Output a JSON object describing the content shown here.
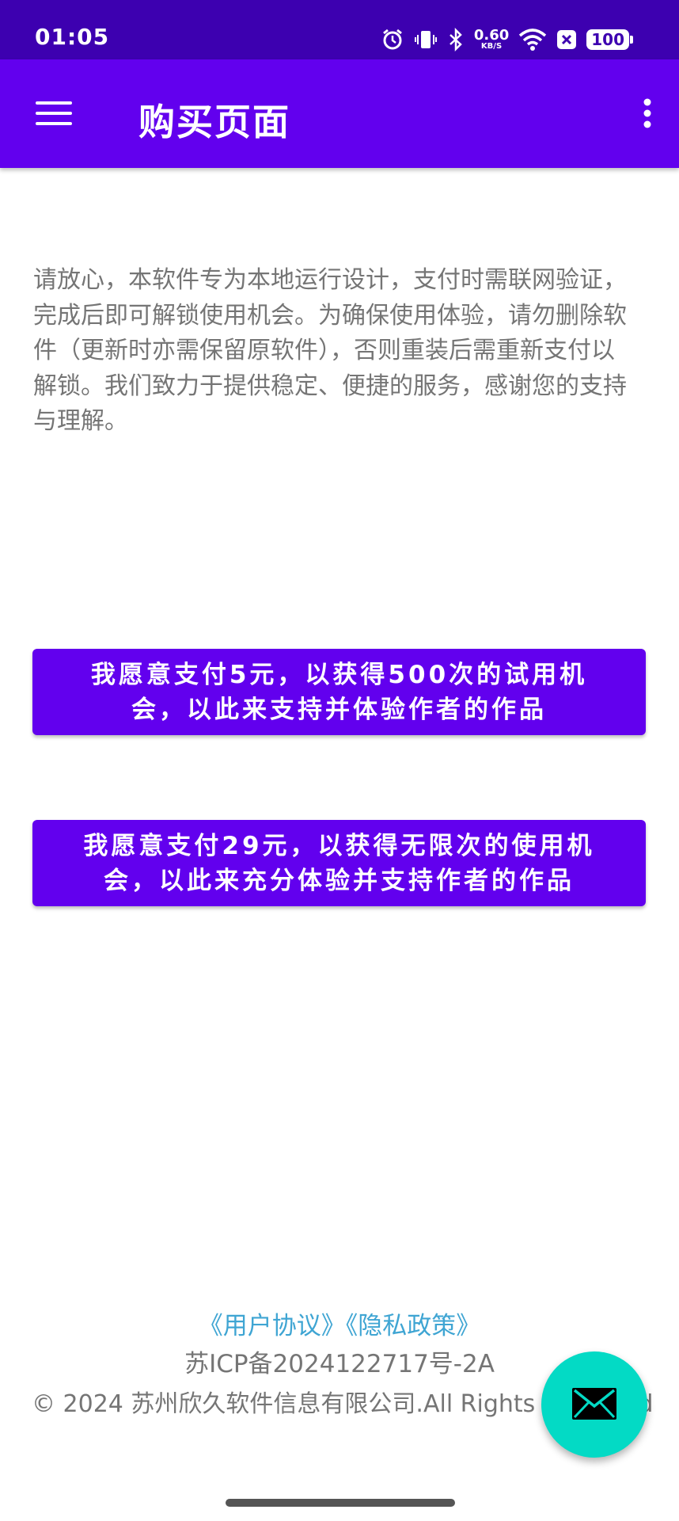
{
  "status_bar": {
    "time": "01:05",
    "net_speed": "0.60",
    "net_speed_unit": "KB/S",
    "battery": "100",
    "icons": [
      "alarm-icon",
      "vibrate-icon",
      "bluetooth-icon",
      "wifi-icon",
      "x-notification-icon",
      "battery-icon"
    ]
  },
  "app_bar": {
    "title": "购买页面",
    "menu_icon": "hamburger-menu-icon",
    "more_icon": "more-vert-icon",
    "color": "#6200ee"
  },
  "notice": {
    "text": "请放心，本软件专为本地运行设计，支付时需联网验证，完成后即可解锁使用机会。为确保使用体验，请勿删除软件（更新时亦需保留原软件），否则重装后需重新支付以解锁。我们致力于提供稳定、便捷的服务，感谢您的支持与理解。"
  },
  "buttons": {
    "pay_5": "我愿意支付5元，以获得500次的试用机会，以此来支持并体验作者的作品",
    "pay_29": "我愿意支付29元，以获得无限次的使用机会，以此来充分体验并支持作者的作品",
    "color": "#6200ee"
  },
  "footer": {
    "user_agreement": "《用户协议》",
    "privacy_policy": "《隐私政策》",
    "icp": "苏ICP备2024122717号-2A",
    "copyright": "© 2024 苏州欣久软件信息有限公司.All Rights Reserved",
    "link_color": "#3fa5d3"
  },
  "fab": {
    "icon": "mail-icon",
    "color": "#03dac5"
  }
}
